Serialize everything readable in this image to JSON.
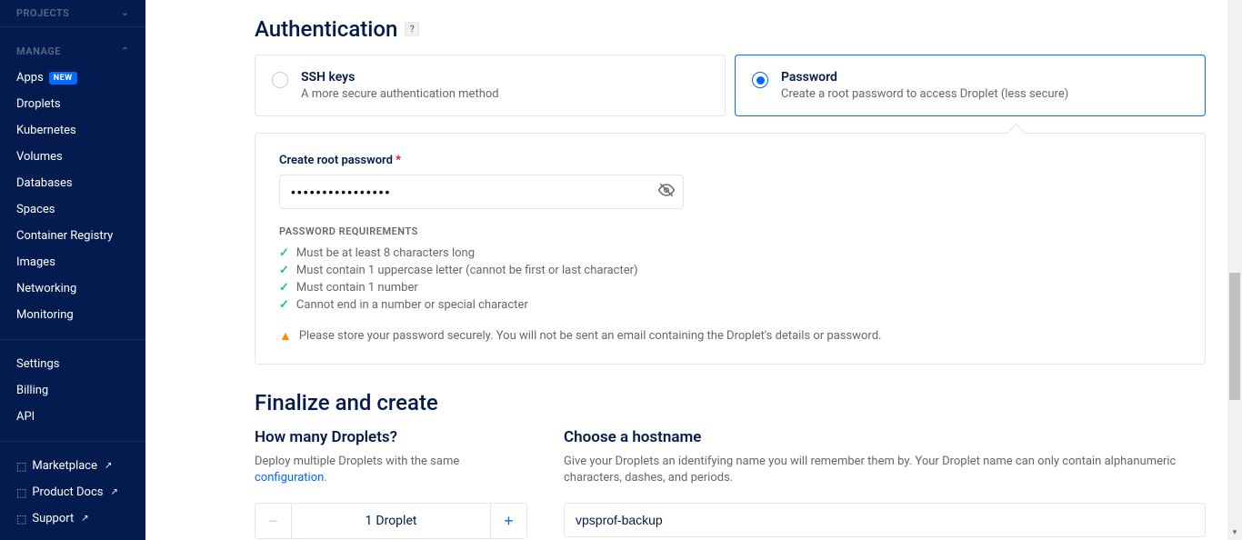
{
  "sidebar": {
    "projects_header": "PROJECTS",
    "manage_header": "MANAGE",
    "items": [
      {
        "label": "Apps",
        "badge": "NEW"
      },
      {
        "label": "Droplets"
      },
      {
        "label": "Kubernetes"
      },
      {
        "label": "Volumes"
      },
      {
        "label": "Databases"
      },
      {
        "label": "Spaces"
      },
      {
        "label": "Container Registry"
      },
      {
        "label": "Images"
      },
      {
        "label": "Networking"
      },
      {
        "label": "Monitoring"
      }
    ],
    "account_items": [
      {
        "label": "Settings"
      },
      {
        "label": "Billing"
      },
      {
        "label": "API"
      }
    ],
    "footer_items": [
      {
        "label": "Marketplace"
      },
      {
        "label": "Product Docs"
      },
      {
        "label": "Support"
      }
    ]
  },
  "auth": {
    "title": "Authentication",
    "help": "?",
    "options": [
      {
        "title": "SSH keys",
        "desc": "A more secure authentication method"
      },
      {
        "title": "Password",
        "desc": "Create a root password to access Droplet (less secure)"
      }
    ],
    "password_label": "Create root password",
    "password_value": "••••••••••••••••",
    "req_title": "PASSWORD REQUIREMENTS",
    "requirements": [
      "Must be at least 8 characters long",
      "Must contain 1 uppercase letter (cannot be first or last character)",
      "Must contain 1 number",
      "Cannot end in a number or special character"
    ],
    "warning": "Please store your password securely. You will not be sent an email containing the Droplet's details or password."
  },
  "finalize": {
    "title": "Finalize and create",
    "droplets_title": "How many Droplets?",
    "droplets_desc_pre": "Deploy multiple Droplets with the same ",
    "droplets_desc_link": "configuration",
    "droplets_desc_post": ".",
    "droplet_count": "1",
    "droplet_unit": "Droplet",
    "hostname_title": "Choose a hostname",
    "hostname_desc": "Give your Droplets an identifying name you will remember them by. Your Droplet name can only contain alphanumeric characters, dashes, and periods.",
    "hostname_value": "vpsprof-backup"
  }
}
